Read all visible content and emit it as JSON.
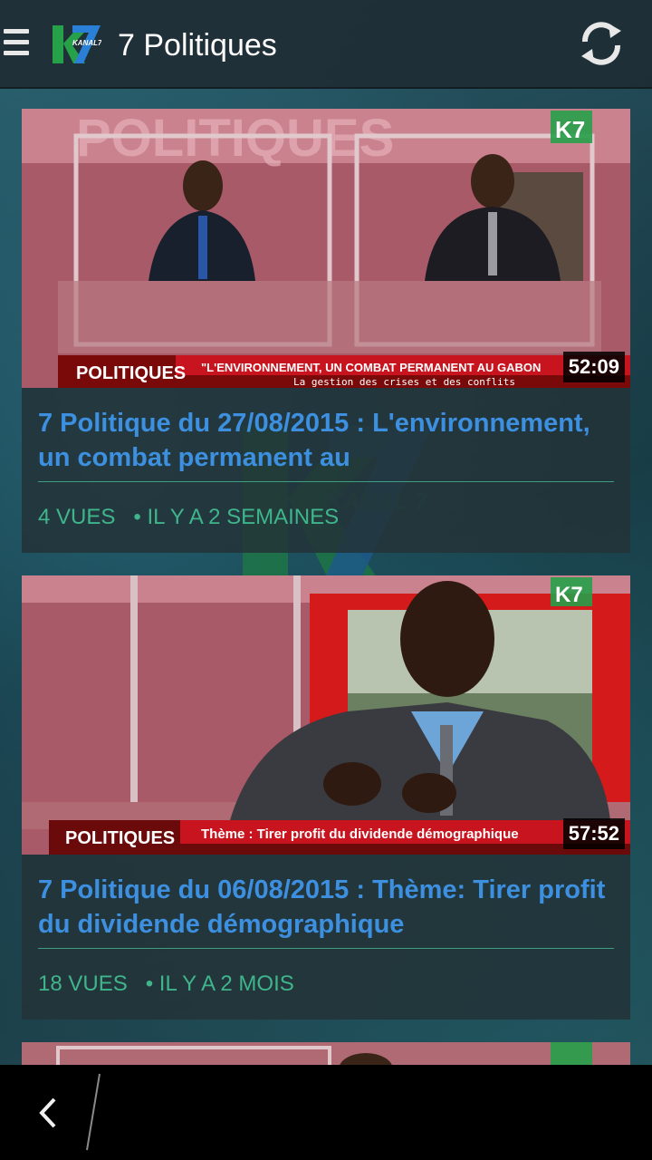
{
  "app": {
    "title": "7 Politiques",
    "logo_text": "KANAL 7",
    "accent": "#3d8fe0",
    "meta_color": "#3fb58c"
  },
  "icons": {
    "menu": "hamburger-icon",
    "refresh": "refresh-icon",
    "back": "back-icon"
  },
  "videos": [
    {
      "title": "7 Politique du 27/08/2015 : L'environnement, un combat permanent au",
      "duration": "52:09",
      "views": "4 VUES",
      "age": "• IL Y A 2 SEMAINES",
      "banner_tag": "POLITIQUES",
      "banner_text": "\"L'ENVIRONNEMENT, UN COMBAT PERMANENT AU GABON",
      "banner_sub": "La gestion des crises et des conflits",
      "channel_bug": "K7"
    },
    {
      "title": "7 Politique du 06/08/2015 : Thème: Tirer profit du dividende démographique",
      "duration": "57:52",
      "views": "18 VUES",
      "age": "• IL Y A 2 MOIS",
      "banner_tag": "POLITIQUES",
      "banner_text": "Thème : Tirer profit du dividende démographique",
      "channel_bug": "K7"
    }
  ]
}
